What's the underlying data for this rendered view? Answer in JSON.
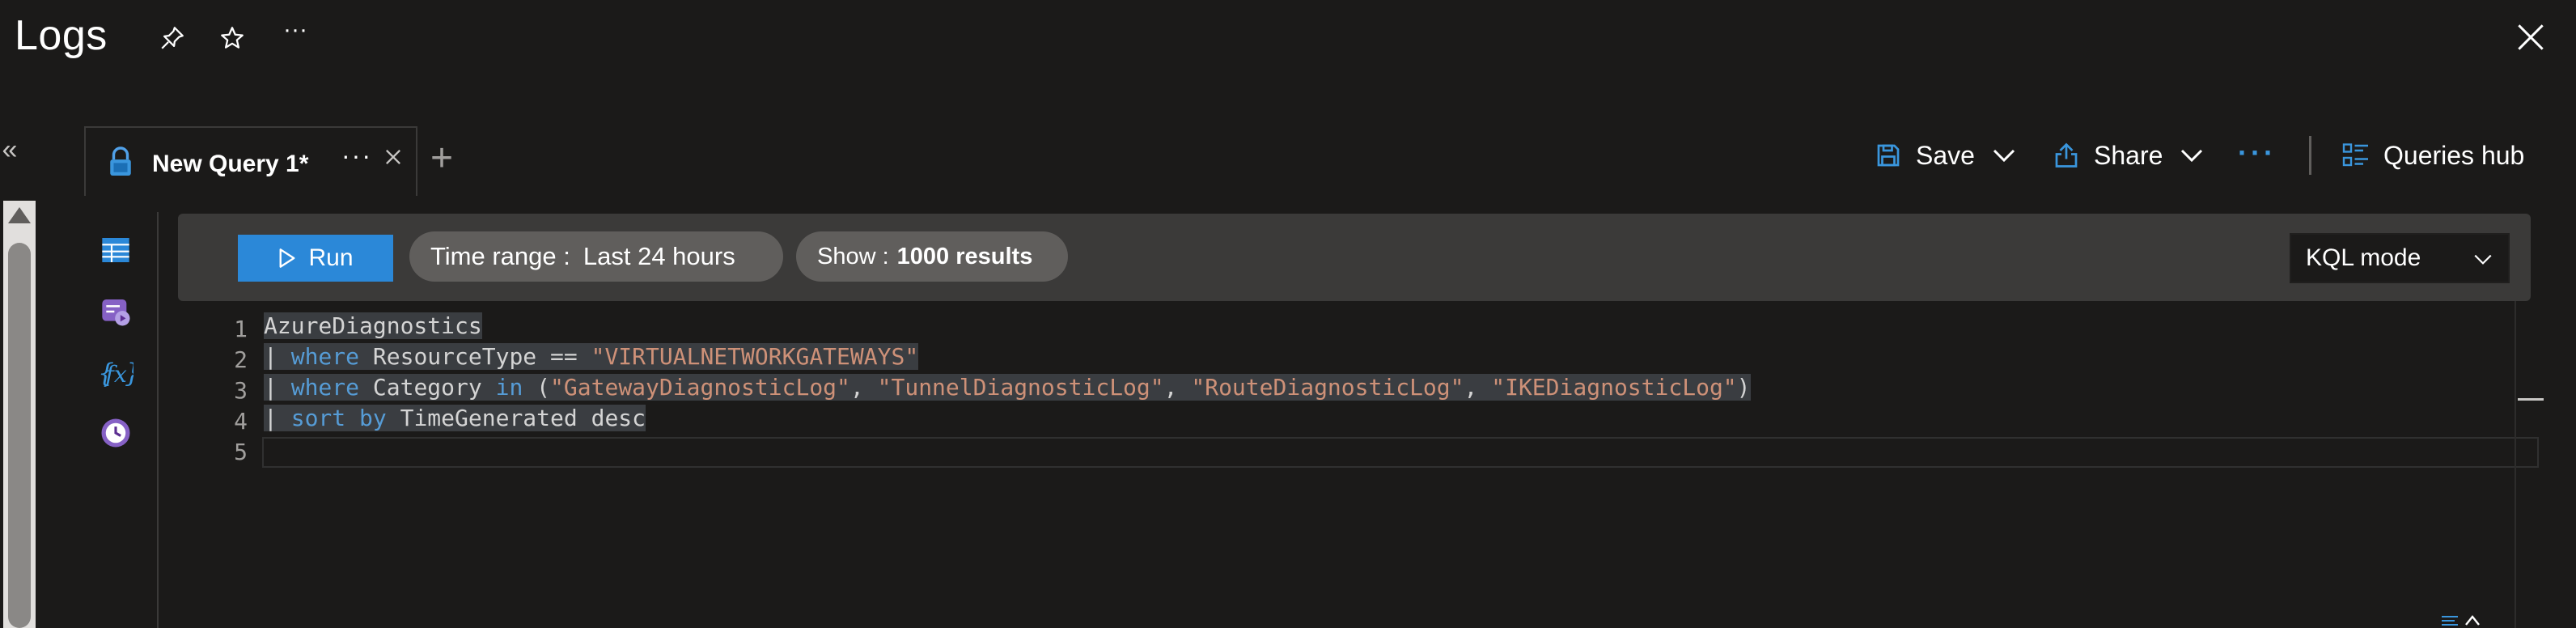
{
  "header": {
    "title": "Logs",
    "pin_icon": "pin-icon",
    "favorite_icon": "star-icon",
    "more_label": "···",
    "close_icon": "close-icon"
  },
  "sidebar": {
    "collapse_label": "«"
  },
  "tabs": [
    {
      "label": "New Query 1*",
      "icon": "lock-icon",
      "more_label": "···",
      "active": true
    }
  ],
  "tab_add_label": "+",
  "toolbar": {
    "save_label": "Save",
    "share_label": "Share",
    "more_label": "···",
    "queries_hub_label": "Queries hub"
  },
  "rail": [
    {
      "name": "tables-icon"
    },
    {
      "name": "queries-icon"
    },
    {
      "name": "functions-icon"
    },
    {
      "name": "query-history-icon"
    }
  ],
  "query_bar": {
    "run_label": "Run",
    "time_range_label": "Time range :",
    "time_range_value": "Last 24 hours",
    "show_label": "Show :",
    "show_value": "1000 results",
    "mode_value": "KQL mode"
  },
  "editor": {
    "line_numbers": [
      "1",
      "2",
      "3",
      "4",
      "5"
    ],
    "lines": [
      "AzureDiagnostics",
      "| where ResourceType == \"VIRTUALNETWORKGATEWAYS\"",
      "| where Category in (\"GatewayDiagnosticLog\", \"TunnelDiagnosticLog\", \"RouteDiagnosticLog\", \"IKEDiagnosticLog\")",
      "| sort by TimeGenerated desc",
      ""
    ]
  },
  "colors": {
    "background": "#1b1a19",
    "accent": "#2b88d8",
    "keyword": "#569cd6",
    "string": "#ce9178",
    "pill": "#605e5c"
  }
}
